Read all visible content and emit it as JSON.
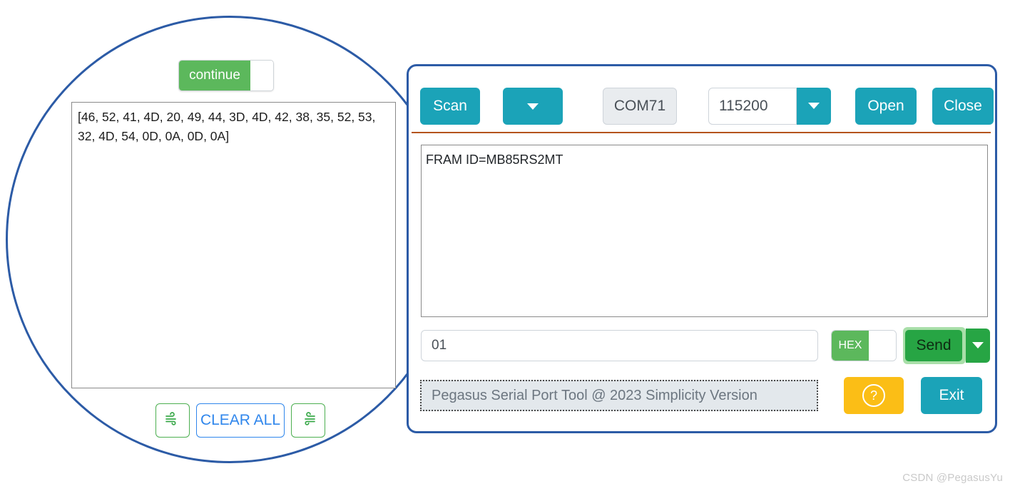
{
  "app": {
    "panel_border_color": "#2c5ba6",
    "accent_teal": "#1ba3b8",
    "accent_green": "#27a544",
    "accent_yellow": "#fbbe16",
    "separator_color": "#b5541d"
  },
  "toolbar": {
    "scan_label": "Scan",
    "scan_dropdown_icon": "chevron-down-icon",
    "port_value": "COM71",
    "baudrate_value": "115200",
    "baudrate_dropdown_icon": "chevron-down-icon",
    "open_label": "Open",
    "close_label": "Close"
  },
  "receive": {
    "text": "FRAM ID=MB85RS2MT"
  },
  "send": {
    "input_value": "01",
    "hex_toggle_label": "HEX",
    "hex_toggle_state": "on",
    "send_label": "Send",
    "send_dropdown_icon": "chevron-down-icon"
  },
  "status": {
    "text": "Pegasus Serial Port Tool @ 2023 Simplicity Version",
    "help_icon": "question-mark-circle-icon",
    "exit_label": "Exit"
  },
  "magnified": {
    "toggle_label": "continue",
    "toggle_state": "on",
    "textarea_text": "[46, 52, 41, 4D, 20, 49, 44, 3D, 4D, 42, 38, 35, 52, 53, 32, 4D, 54, 0D, 0A, 0D, 0A]",
    "clear_all_label": "CLEAR ALL",
    "left_icon": "wind-icon",
    "right_icon": "wind-icon-mirrored"
  },
  "watermark": {
    "text": "CSDN @PegasusYu"
  }
}
